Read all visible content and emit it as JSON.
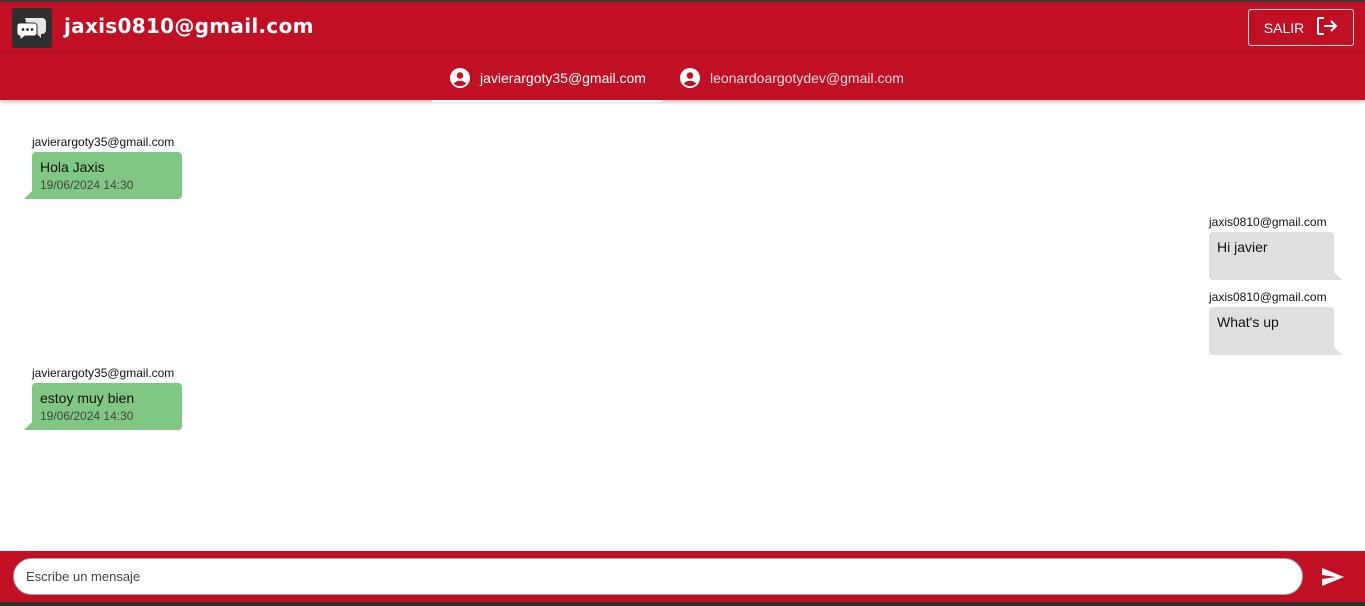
{
  "header": {
    "title": "jaxis0810@gmail.com",
    "logout_label": "SALIR",
    "logo_icon": "chat-bubbles-icon",
    "logout_icon": "logout-icon",
    "accent_color": "#c10f24"
  },
  "tabs": [
    {
      "label": "javierargoty35@gmail.com",
      "icon": "account-circle-icon",
      "active": true
    },
    {
      "label": "leonardoargotydev@gmail.com",
      "icon": "account-circle-icon",
      "active": false
    }
  ],
  "messages": [
    {
      "sender": "javierargoty35@gmail.com",
      "text": "Hola Jaxis",
      "time": "19/06/2024 14:30",
      "side": "left"
    },
    {
      "sender": "jaxis0810@gmail.com",
      "text": "Hi javier",
      "time": "",
      "side": "right"
    },
    {
      "sender": "jaxis0810@gmail.com",
      "text": "What's up",
      "time": "",
      "side": "right"
    },
    {
      "sender": "javierargoty35@gmail.com",
      "text": "estoy muy bien",
      "time": "19/06/2024 14:30",
      "side": "left"
    }
  ],
  "composer": {
    "placeholder": "Escribe un mensaje",
    "send_icon": "send-icon"
  }
}
